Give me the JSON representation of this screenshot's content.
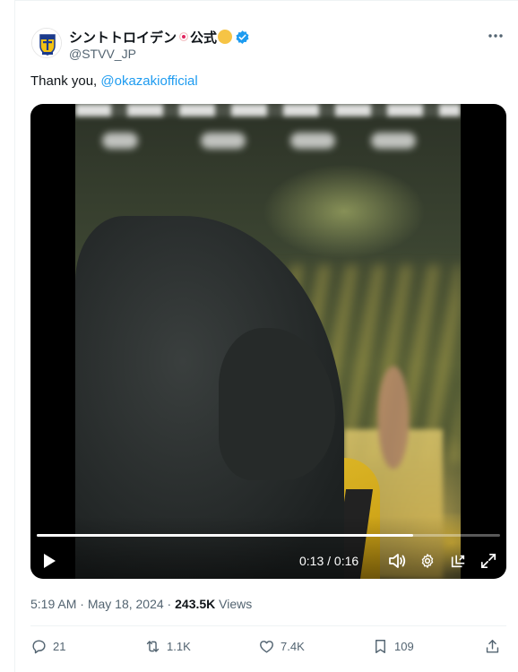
{
  "author": {
    "display_name": "シントトロイデン",
    "name_tail": "公式",
    "handle": "@STVV_JP",
    "verified_icon": "verified-badge-icon",
    "avatar_icon": "stvv-crest-icon"
  },
  "tweet": {
    "text": "Thank you, ",
    "mention": "@okazakiofficial"
  },
  "video": {
    "time": "0:13 / 0:16",
    "progress": 0.8125
  },
  "meta": {
    "time": "5:19 AM",
    "separator": " · ",
    "date": "May 18, 2024",
    "views_count": "243.5K",
    "views_label": " Views"
  },
  "actions": {
    "replies": "21",
    "reposts": "1.1K",
    "likes": "7.4K",
    "bookmarks": "109"
  },
  "colors": {
    "accent": "#1d9bf0",
    "text": "#0f1419",
    "muted": "#536471"
  }
}
